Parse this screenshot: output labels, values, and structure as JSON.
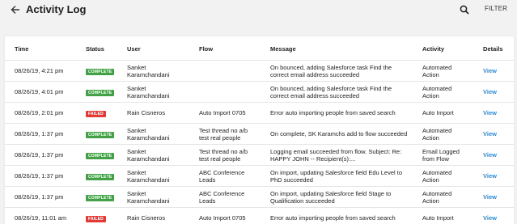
{
  "header": {
    "title": "Activity Log",
    "filter_label": "FILTER"
  },
  "colors": {
    "complete": "#43a047",
    "failed": "#e53935",
    "link": "#2a8bd6"
  },
  "table": {
    "columns": [
      "Time",
      "Status",
      "User",
      "Flow",
      "Message",
      "Activity",
      "Details"
    ],
    "rows": [
      {
        "time": "08/26/19, 4:21 pm",
        "status": "COMPLETE",
        "user": [
          "Sanket",
          "Karamchandani"
        ],
        "flow": [],
        "message": [
          "On bounced, adding Salesforce task Find the",
          "correct email address succeeded"
        ],
        "activity": [
          "Automated",
          "Action"
        ],
        "details": "View"
      },
      {
        "time": "08/26/19, 4:01 pm",
        "status": "COMPLETE",
        "user": [
          "Sanket",
          "Karamchandani"
        ],
        "flow": [],
        "message": [
          "On bounced, adding Salesforce task Find the",
          "correct email address succeeded"
        ],
        "activity": [
          "Automated",
          "Action"
        ],
        "details": "View"
      },
      {
        "time": "08/26/19, 2:01 pm",
        "status": "FAILED",
        "user": [
          "Rain Cisneros"
        ],
        "flow": [
          "Auto Import 0705"
        ],
        "message": [
          "Error auto importing people from saved search"
        ],
        "activity": [
          "Auto Import"
        ],
        "details": "View"
      },
      {
        "time": "08/26/19, 1:37 pm",
        "status": "COMPLETE",
        "user": [
          "Sanket",
          "Karamchandani"
        ],
        "flow": [
          "Test thread no a/b",
          "test real people"
        ],
        "message": [
          "On complete, SK Karamchs add to flow succeeded"
        ],
        "activity": [
          "Automated",
          "Action"
        ],
        "details": "View"
      },
      {
        "time": "08/26/19, 1:37 pm",
        "status": "COMPLETE",
        "user": [
          "Sanket",
          "Karamchandani"
        ],
        "flow": [
          "Test thread no a/b",
          "test real people"
        ],
        "message": [
          "Logging email succeeded from flow. Subject: Re:",
          "HAPPY JOHN -- Recipient(s):..."
        ],
        "activity": [
          "Email Logged",
          "from Flow"
        ],
        "details": "View"
      },
      {
        "time": "08/26/19, 1:37 pm",
        "status": "COMPLETE",
        "user": [
          "Sanket",
          "Karamchandani"
        ],
        "flow": [
          "ABC Conference",
          "Leads"
        ],
        "message": [
          "On import, updating Salesforce field Edu Level to",
          "PhD succeeded"
        ],
        "activity": [
          "Automated",
          "Action"
        ],
        "details": "View"
      },
      {
        "time": "08/26/19, 1:37 pm",
        "status": "COMPLETE",
        "user": [
          "Sanket",
          "Karamchandani"
        ],
        "flow": [
          "ABC Conference",
          "Leads"
        ],
        "message": [
          "On import, updating Salesforce field Stage to",
          "Qualification succeeded"
        ],
        "activity": [
          "Automated",
          "Action"
        ],
        "details": "View"
      },
      {
        "time": "08/26/19, 11:01 am",
        "status": "FAILED",
        "user": [
          "Rain Cisneros"
        ],
        "flow": [
          "Auto Import 0705"
        ],
        "message": [
          "Error auto importing people from saved search"
        ],
        "activity": [
          "Auto Import"
        ],
        "details": "View"
      }
    ]
  }
}
